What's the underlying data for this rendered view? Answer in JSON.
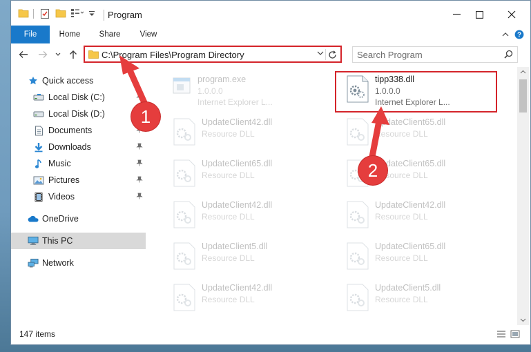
{
  "window": {
    "title": "Program"
  },
  "ribbon": {
    "tabs": [
      "File",
      "Home",
      "Share",
      "View"
    ]
  },
  "address": {
    "path": "C:\\Program Files\\Program Directory"
  },
  "search": {
    "placeholder": "Search Program"
  },
  "sidebar": {
    "items": [
      {
        "label": "Quick access",
        "icon": "star-icon"
      },
      {
        "label": "Local Disk (C:)",
        "icon": "drive-icon"
      },
      {
        "label": "Local Disk (D:)",
        "icon": "drive-icon"
      },
      {
        "label": "Documents",
        "icon": "documents-icon"
      },
      {
        "label": "Downloads",
        "icon": "download-arrow-icon"
      },
      {
        "label": "Music",
        "icon": "music-note-icon"
      },
      {
        "label": "Pictures",
        "icon": "pictures-icon"
      },
      {
        "label": "Videos",
        "icon": "film-icon"
      },
      {
        "label": "OneDrive",
        "icon": "cloud-icon"
      },
      {
        "label": "This PC",
        "icon": "monitor-icon"
      },
      {
        "label": "Network",
        "icon": "network-icon"
      }
    ]
  },
  "files": [
    {
      "name": "program.exe",
      "line2": "1.0.0.0",
      "line3": "Internet Explorer L..."
    },
    {
      "name": "tipp338.dll",
      "line2": "1.0.0.0",
      "line3": "Internet Explorer L..."
    },
    {
      "name": "UpdateClient42.dll",
      "line2": "Resource DLL"
    },
    {
      "name": "UpdateClient65.dll",
      "line2": "Resource DLL"
    },
    {
      "name": "UpdateClient65.dll",
      "line2": "Resource DLL"
    },
    {
      "name": "UpdateClient65.dll",
      "line2": "Resource DLL"
    },
    {
      "name": "UpdateClient42.dll",
      "line2": "Resource DLL"
    },
    {
      "name": "UpdateClient42.dll",
      "line2": "Resource DLL"
    },
    {
      "name": "UpdateClient5.dll",
      "line2": "Resource DLL"
    },
    {
      "name": "UpdateClient65.dll",
      "line2": "Resource DLL"
    },
    {
      "name": "UpdateClient42.dll",
      "line2": "Resource DLL"
    },
    {
      "name": "UpdateClient5.dll",
      "line2": "Resource DLL"
    }
  ],
  "status": {
    "item_count": "147 items"
  },
  "annotations": {
    "callout1": "1",
    "callout2": "2"
  },
  "colors": {
    "highlight": "#d4242a",
    "accent": "#1979ca",
    "callout": "#e53d3d"
  }
}
